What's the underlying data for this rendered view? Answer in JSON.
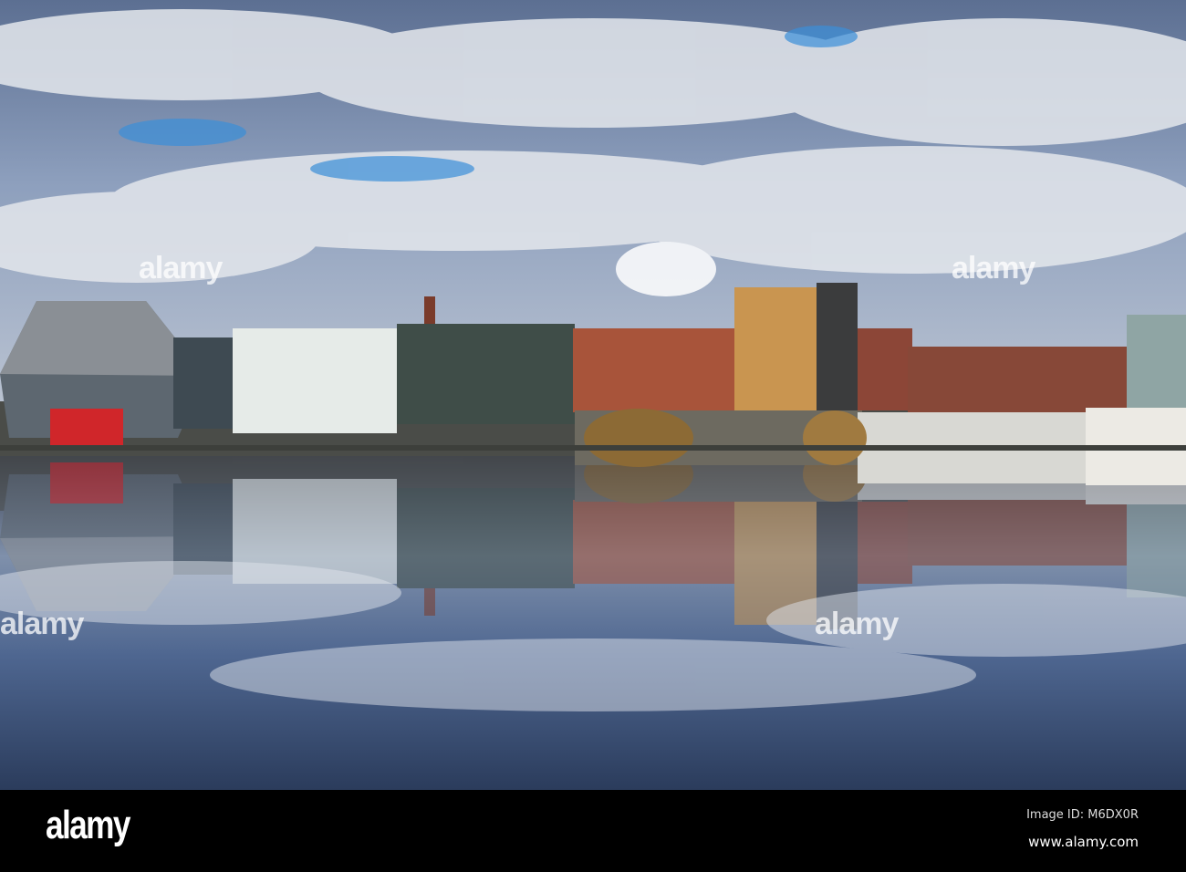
{
  "watermark": {
    "text": "alamy"
  },
  "footer": {
    "logo": "alamy",
    "image_id": "Image ID: M6DX0R",
    "url": "www.alamy.com"
  }
}
